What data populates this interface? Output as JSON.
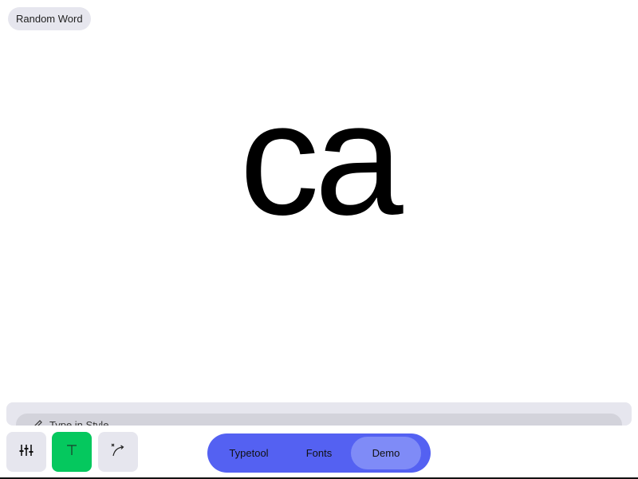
{
  "random_button": {
    "label": "Random Word"
  },
  "preview": {
    "text": "ca"
  },
  "panel": {
    "label": "Type in Style",
    "icon": "pen-icon"
  },
  "toolbar": {
    "tools": [
      {
        "name": "sliders-icon",
        "active": false
      },
      {
        "name": "text-tool-icon",
        "active": true
      },
      {
        "name": "curve-tool-icon",
        "active": false
      }
    ],
    "active_color": "#05c85e",
    "button_color": "#e6e6ee"
  },
  "nav": {
    "tabs": [
      {
        "label": "Typetool",
        "selected": false
      },
      {
        "label": "Fonts",
        "selected": false
      },
      {
        "label": "Demo",
        "selected": true
      }
    ],
    "pill_color": "#5461f2",
    "selected_color": "#7f8bf7"
  }
}
